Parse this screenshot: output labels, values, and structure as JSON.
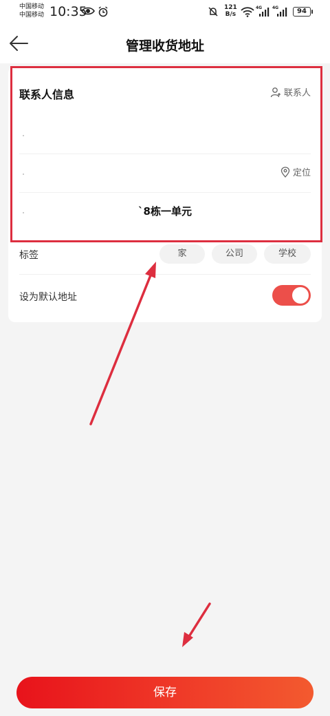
{
  "status_bar": {
    "carrier_1": "中国移动",
    "carrier_2": "中国移动",
    "time": "10:35",
    "net_speed_value": "121",
    "net_speed_unit": "B/s",
    "battery": "94",
    "signal_1_label": "4G",
    "signal_2_label": "4G"
  },
  "header": {
    "title": "管理收货地址",
    "back_icon": "arrow-left-icon"
  },
  "contact_section": {
    "title": "联系人信息",
    "contact_link": "联系人",
    "contact_icon": "person-add-icon"
  },
  "address": {
    "locate_label": "定位",
    "locate_icon": "location-pin-icon",
    "detail_value": "`8栋一单元"
  },
  "tags": {
    "label": "标签",
    "options": [
      "家",
      "公司",
      "学校"
    ]
  },
  "default_address": {
    "label": "设为默认地址",
    "enabled": true
  },
  "save_button": "保存",
  "colors": {
    "accent": "#ec4f4a",
    "annotation": "#dd2e3f",
    "save_gradient_start": "#e8131b",
    "save_gradient_end": "#f35a2f"
  }
}
